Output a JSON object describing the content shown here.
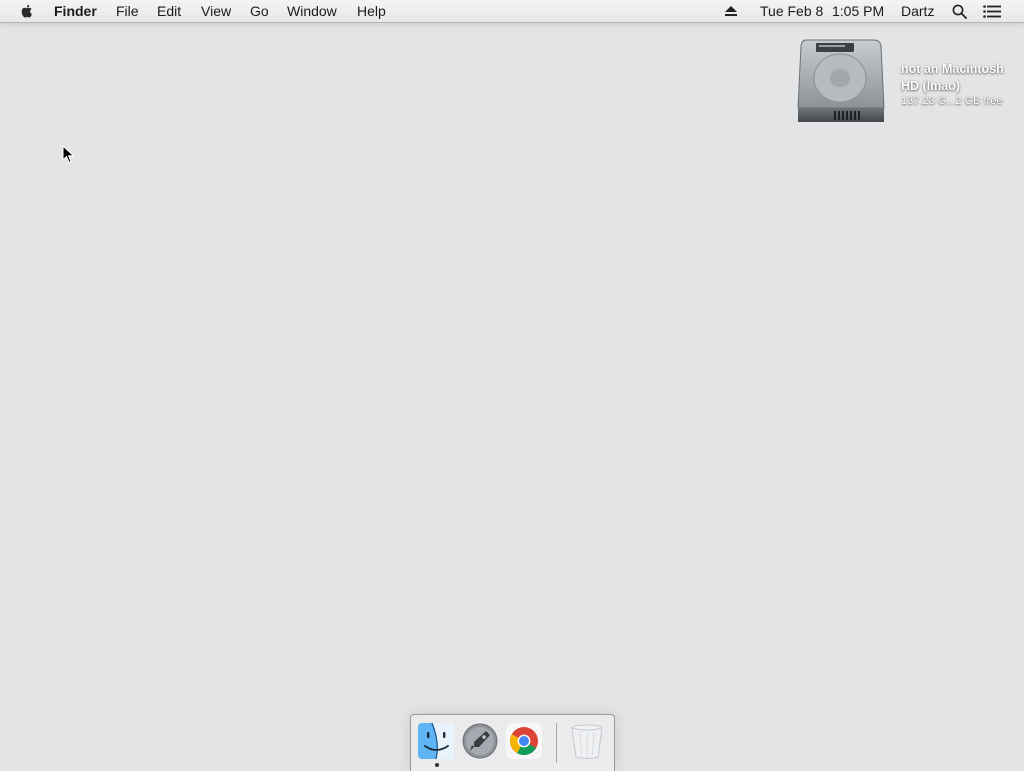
{
  "menubar": {
    "app_name": "Finder",
    "menus": [
      "File",
      "Edit",
      "View",
      "Go",
      "Window",
      "Help"
    ],
    "date": "Tue Feb 8",
    "time": "1:05 PM",
    "user": "Dartz"
  },
  "desktop": {
    "drive": {
      "name_line1": "not an Macintosh",
      "name_line2": "HD (lmao)",
      "info": "137.23 G...2 GB free"
    }
  },
  "dock": {
    "apps": [
      "finder-icon",
      "launchpad-icon",
      "chrome-icon",
      "trash-icon"
    ]
  },
  "colors": {
    "desktop_bg": "#e3e4e6",
    "menubar_bg": "#f0f0f0"
  }
}
